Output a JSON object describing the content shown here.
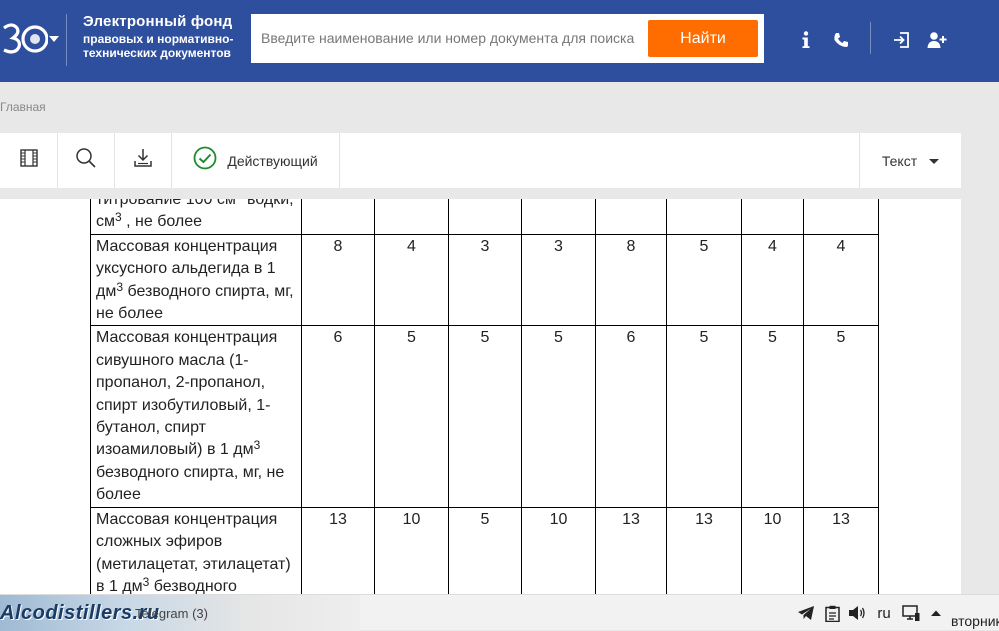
{
  "header": {
    "brand_title": "Электронный фонд",
    "brand_sub1": "правовых и нормативно-",
    "brand_sub2": "технических документов",
    "search_placeholder": "Введите наименование или номер документа для поиска",
    "search_button": "Найти",
    "icons": [
      "logo-30-icon",
      "info-icon",
      "phone-icon",
      "login-icon",
      "register-icon"
    ],
    "accent_color": "#2e4f9e",
    "button_color": "#ff6d00"
  },
  "breadcrumb": "Главная",
  "toolbar": {
    "status": "Действующий",
    "view": "Текст",
    "icons": [
      "contents-icon",
      "search-icon",
      "download-icon",
      "check-circle-icon"
    ],
    "status_color": "#1e8c2e"
  },
  "table": {
    "rows": [
      {
        "label_parts": [
          "титрование 100 см",
          "3",
          " водки, см",
          "3",
          " , не более"
        ],
        "values": [
          "",
          "",
          "",
          "",
          "",
          "",
          "",
          ""
        ]
      },
      {
        "label_parts": [
          "Массовая концентрация уксусного альдегида в 1 дм",
          "3",
          "  безводного спирта, мг, не более"
        ],
        "values": [
          "8",
          "4",
          "3",
          "3",
          "8",
          "5",
          "4",
          "4"
        ]
      },
      {
        "label_parts": [
          "Массовая концентрация сивушного масла (1-пропанол, 2-пропанол, спирт изобутиловый, 1-бутанол, спирт изоамиловый) в 1 дм",
          "3",
          " безводного спирта, мг, не более"
        ],
        "values": [
          "6",
          "5",
          "5",
          "5",
          "6",
          "5",
          "5",
          "5"
        ]
      },
      {
        "label_parts": [
          "Массовая концентрация сложных эфиров (метилацетат, этилацетат) в 1 дм",
          "3",
          " безводного"
        ],
        "values": [
          "13",
          "10",
          "5",
          "10",
          "13",
          "13",
          "10",
          "13"
        ]
      }
    ]
  },
  "taskbar": {
    "watermark": "Alcodistillers.ru",
    "task_label": "Telegram (3)",
    "lang": "ru",
    "date": "вторник",
    "icons": [
      "telegram-icon",
      "clipboard-icon",
      "volume-icon",
      "monitor-icon",
      "tray-up-icon"
    ]
  }
}
